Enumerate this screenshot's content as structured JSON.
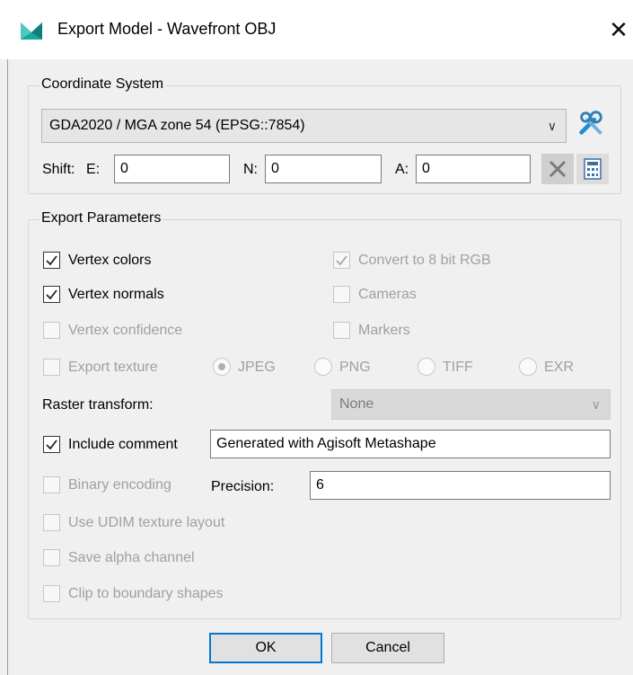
{
  "window": {
    "title": "Export Model - Wavefront OBJ",
    "close_symbol": "✕"
  },
  "coord": {
    "group_title": "Coordinate System",
    "crs_value": "GDA2020 / MGA zone 54 (EPSG::7854)",
    "shift_label": "Shift:",
    "e_label": "E:",
    "e_value": "0",
    "n_label": "N:",
    "n_value": "0",
    "a_label": "A:",
    "a_value": "0"
  },
  "params": {
    "group_title": "Export Parameters",
    "vertex_colors": {
      "label": "Vertex colors",
      "checked": true,
      "enabled": true
    },
    "convert_8bit": {
      "label": "Convert to 8 bit RGB",
      "checked": true,
      "enabled": false
    },
    "vertex_normals": {
      "label": "Vertex normals",
      "checked": true,
      "enabled": true
    },
    "cameras": {
      "label": "Cameras",
      "checked": false,
      "enabled": false
    },
    "vertex_confidence": {
      "label": "Vertex confidence",
      "checked": false,
      "enabled": false
    },
    "markers": {
      "label": "Markers",
      "checked": false,
      "enabled": false
    },
    "export_texture": {
      "label": "Export texture",
      "checked": false,
      "enabled": false
    },
    "texture_formats": [
      "JPEG",
      "PNG",
      "TIFF",
      "EXR"
    ],
    "selected_format": "JPEG",
    "raster_label": "Raster transform:",
    "raster_value": "None",
    "include_comment": {
      "label": "Include comment",
      "checked": true,
      "enabled": true
    },
    "comment_value": "Generated with Agisoft Metashape",
    "binary_encoding": {
      "label": "Binary encoding",
      "checked": false,
      "enabled": false
    },
    "precision_label": "Precision:",
    "precision_value": "6",
    "use_udim": {
      "label": "Use UDIM texture layout",
      "checked": false,
      "enabled": false
    },
    "save_alpha": {
      "label": "Save alpha channel",
      "checked": false,
      "enabled": false
    },
    "clip_boundary": {
      "label": "Clip to boundary shapes",
      "checked": false,
      "enabled": false
    }
  },
  "buttons": {
    "ok": "OK",
    "cancel": "Cancel"
  },
  "colors": {
    "accent": "#0078d7",
    "disabled_text": "#a0a0a0",
    "icon_teal": "#1aa39a"
  }
}
